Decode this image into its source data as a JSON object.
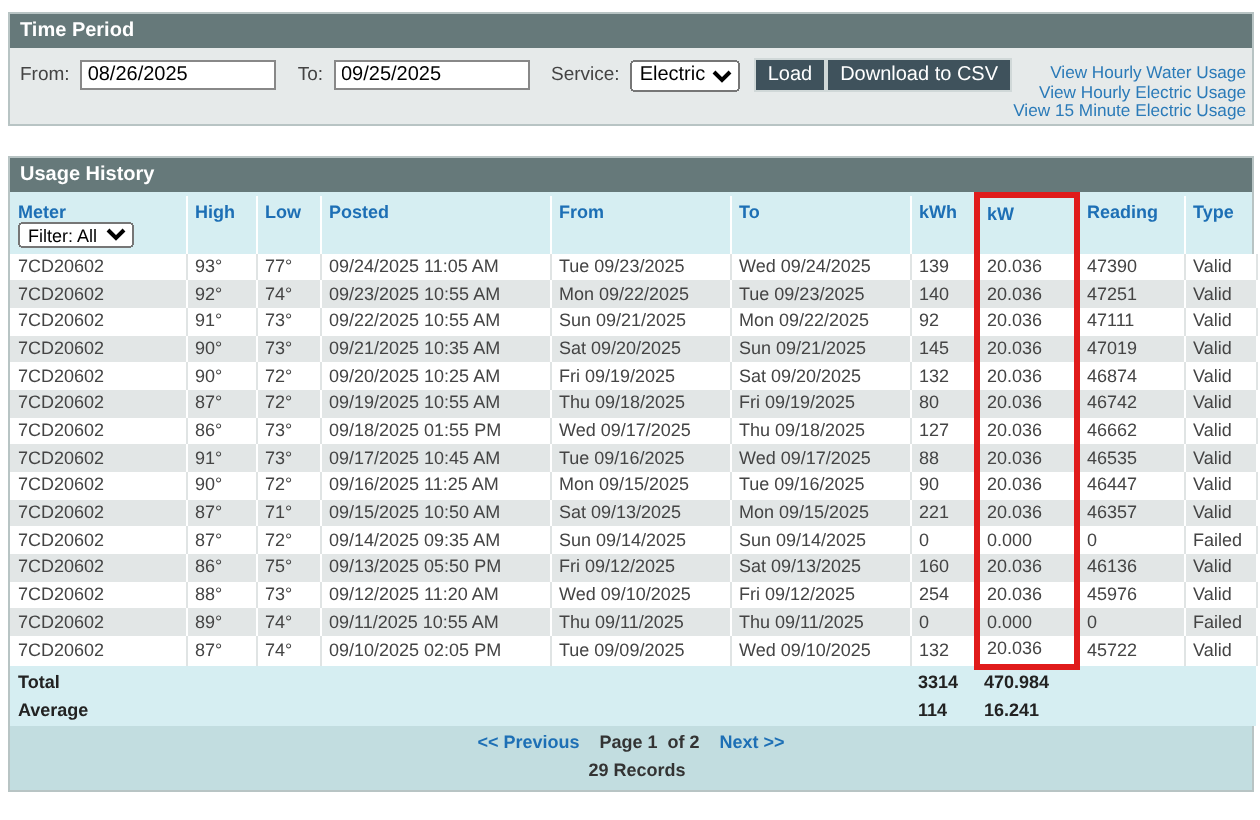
{
  "time_period": {
    "title": "Time Period",
    "from_label": "From:",
    "from_value": "08/26/2025",
    "to_label": "To:",
    "to_value": "09/25/2025",
    "service_label": "Service:",
    "service_value": "Electric",
    "buttons": [
      "Load",
      "Download to CSV"
    ],
    "links": [
      "View Hourly Water Usage",
      "View Hourly Electric Usage",
      "View 15 Minute Electric Usage"
    ]
  },
  "usage_history": {
    "title": "Usage History",
    "meter_filter": "Filter: All",
    "columns": [
      {
        "label": "Meter",
        "highlighted": false
      },
      {
        "label": "High",
        "highlighted": false
      },
      {
        "label": "Low",
        "highlighted": false
      },
      {
        "label": "Posted",
        "highlighted": false
      },
      {
        "label": "From",
        "highlighted": false
      },
      {
        "label": "To",
        "highlighted": false
      },
      {
        "label": "kWh",
        "highlighted": false
      },
      {
        "label": "kW",
        "highlighted": true
      },
      {
        "label": "Reading",
        "highlighted": false
      },
      {
        "label": "Type",
        "highlighted": false
      }
    ],
    "rows": [
      [
        "7CD20602",
        "93°",
        "77°",
        "09/24/2025 11:05 AM",
        "Tue 09/23/2025",
        "Wed 09/24/2025",
        "139",
        "20.036",
        "47390",
        "Valid"
      ],
      [
        "7CD20602",
        "92°",
        "74°",
        "09/23/2025 10:55 AM",
        "Mon 09/22/2025",
        "Tue 09/23/2025",
        "140",
        "20.036",
        "47251",
        "Valid"
      ],
      [
        "7CD20602",
        "91°",
        "73°",
        "09/22/2025 10:55 AM",
        "Sun 09/21/2025",
        "Mon 09/22/2025",
        "92",
        "20.036",
        "47111",
        "Valid"
      ],
      [
        "7CD20602",
        "90°",
        "73°",
        "09/21/2025 10:35 AM",
        "Sat 09/20/2025",
        "Sun 09/21/2025",
        "145",
        "20.036",
        "47019",
        "Valid"
      ],
      [
        "7CD20602",
        "90°",
        "72°",
        "09/20/2025 10:25 AM",
        "Fri 09/19/2025",
        "Sat 09/20/2025",
        "132",
        "20.036",
        "46874",
        "Valid"
      ],
      [
        "7CD20602",
        "87°",
        "72°",
        "09/19/2025 10:55 AM",
        "Thu 09/18/2025",
        "Fri 09/19/2025",
        "80",
        "20.036",
        "46742",
        "Valid"
      ],
      [
        "7CD20602",
        "86°",
        "73°",
        "09/18/2025 01:55 PM",
        "Wed 09/17/2025",
        "Thu 09/18/2025",
        "127",
        "20.036",
        "46662",
        "Valid"
      ],
      [
        "7CD20602",
        "91°",
        "73°",
        "09/17/2025 10:45 AM",
        "Tue 09/16/2025",
        "Wed 09/17/2025",
        "88",
        "20.036",
        "46535",
        "Valid"
      ],
      [
        "7CD20602",
        "90°",
        "72°",
        "09/16/2025 11:25 AM",
        "Mon 09/15/2025",
        "Tue 09/16/2025",
        "90",
        "20.036",
        "46447",
        "Valid"
      ],
      [
        "7CD20602",
        "87°",
        "71°",
        "09/15/2025 10:50 AM",
        "Sat 09/13/2025",
        "Mon 09/15/2025",
        "221",
        "20.036",
        "46357",
        "Valid"
      ],
      [
        "7CD20602",
        "87°",
        "72°",
        "09/14/2025 09:35 AM",
        "Sun 09/14/2025",
        "Sun 09/14/2025",
        "0",
        "0.000",
        "0",
        "Failed"
      ],
      [
        "7CD20602",
        "86°",
        "75°",
        "09/13/2025 05:50 PM",
        "Fri 09/12/2025",
        "Sat 09/13/2025",
        "160",
        "20.036",
        "46136",
        "Valid"
      ],
      [
        "7CD20602",
        "88°",
        "73°",
        "09/12/2025 11:20 AM",
        "Wed 09/10/2025",
        "Fri 09/12/2025",
        "254",
        "20.036",
        "45976",
        "Valid"
      ],
      [
        "7CD20602",
        "89°",
        "74°",
        "09/11/2025 10:55 AM",
        "Thu 09/11/2025",
        "Thu 09/11/2025",
        "0",
        "0.000",
        "0",
        "Failed"
      ],
      [
        "7CD20602",
        "87°",
        "74°",
        "09/10/2025 02:05 PM",
        "Tue 09/09/2025",
        "Wed 09/10/2025",
        "132",
        "20.036",
        "45722",
        "Valid"
      ]
    ],
    "totals": [
      {
        "label": "Total",
        "kwh": "3314",
        "kw": "470.984"
      },
      {
        "label": "Average",
        "kwh": "114",
        "kw": "16.241"
      }
    ],
    "pager": {
      "previous": "<< Previous",
      "page": "Page 1  of 2",
      "next": "Next >>",
      "records": "29 Records"
    }
  }
}
